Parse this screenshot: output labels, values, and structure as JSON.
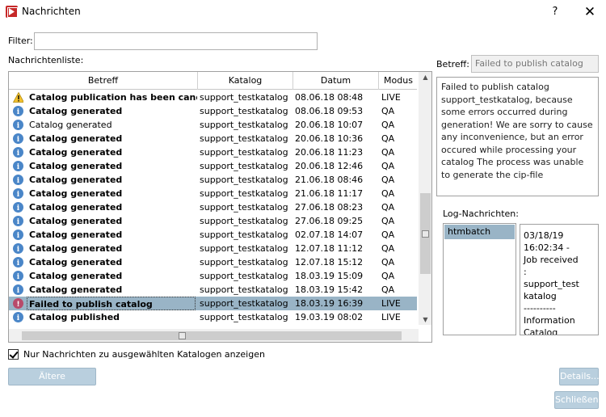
{
  "window": {
    "title": "Nachrichten",
    "help": "?",
    "close": "✕"
  },
  "filter": {
    "label": "Filter:",
    "value": ""
  },
  "list": {
    "label": "Nachrichtenliste:",
    "columns": [
      "Betreff",
      "Katalog",
      "Datum",
      "Modus"
    ],
    "rows": [
      {
        "icon": "warning",
        "betreff": "Catalog publication has been cancelled",
        "katalog": "support_testkatalog",
        "datum": "08.06.18 08:48",
        "modus": "LIVE",
        "bold": true
      },
      {
        "icon": "info",
        "betreff": "Catalog generated",
        "katalog": "support_testkatalog",
        "datum": "08.06.18 09:53",
        "modus": "QA",
        "bold": true
      },
      {
        "icon": "info",
        "betreff": "Catalog generated",
        "katalog": "support_testkatalog",
        "datum": "20.06.18 10:07",
        "modus": "QA",
        "bold": false
      },
      {
        "icon": "info",
        "betreff": "Catalog generated",
        "katalog": "support_testkatalog",
        "datum": "20.06.18 10:36",
        "modus": "QA",
        "bold": true
      },
      {
        "icon": "info",
        "betreff": "Catalog generated",
        "katalog": "support_testkatalog",
        "datum": "20.06.18 11:23",
        "modus": "QA",
        "bold": true
      },
      {
        "icon": "info",
        "betreff": "Catalog generated",
        "katalog": "support_testkatalog",
        "datum": "20.06.18 12:46",
        "modus": "QA",
        "bold": true
      },
      {
        "icon": "info",
        "betreff": "Catalog generated",
        "katalog": "support_testkatalog",
        "datum": "21.06.18 08:46",
        "modus": "QA",
        "bold": true
      },
      {
        "icon": "info",
        "betreff": "Catalog generated",
        "katalog": "support_testkatalog",
        "datum": "21.06.18 11:17",
        "modus": "QA",
        "bold": true
      },
      {
        "icon": "info",
        "betreff": "Catalog generated",
        "katalog": "support_testkatalog",
        "datum": "27.06.18 08:23",
        "modus": "QA",
        "bold": true
      },
      {
        "icon": "info",
        "betreff": "Catalog generated",
        "katalog": "support_testkatalog",
        "datum": "27.06.18 09:25",
        "modus": "QA",
        "bold": true
      },
      {
        "icon": "info",
        "betreff": "Catalog generated",
        "katalog": "support_testkatalog",
        "datum": "02.07.18 14:07",
        "modus": "QA",
        "bold": true
      },
      {
        "icon": "info",
        "betreff": "Catalog generated",
        "katalog": "support_testkatalog",
        "datum": "12.07.18 11:12",
        "modus": "QA",
        "bold": true
      },
      {
        "icon": "info",
        "betreff": "Catalog generated",
        "katalog": "support_testkatalog",
        "datum": "12.07.18 15:12",
        "modus": "QA",
        "bold": true
      },
      {
        "icon": "info",
        "betreff": "Catalog generated",
        "katalog": "support_testkatalog",
        "datum": "18.03.19 15:09",
        "modus": "QA",
        "bold": true
      },
      {
        "icon": "info",
        "betreff": "Catalog generated",
        "katalog": "support_testkatalog",
        "datum": "18.03.19 15:42",
        "modus": "QA",
        "bold": true
      },
      {
        "icon": "error",
        "betreff": "Failed to publish catalog",
        "katalog": "support_testkatalog",
        "datum": "18.03.19 16:39",
        "modus": "LIVE",
        "bold": true,
        "selected": true
      },
      {
        "icon": "info",
        "betreff": "Catalog published",
        "katalog": "support_testkatalog",
        "datum": "19.03.19 08:02",
        "modus": "LIVE",
        "bold": true
      }
    ]
  },
  "detail": {
    "betreff_label": "Betreff:",
    "betreff_value": "Failed to publish catalog",
    "message": "Failed to publish catalog support_testkatalog, because some errors occurred during generation! We are sorry to cause any inconvenience, but an error occured while processing your catalog The process was unable to generate the cip-file"
  },
  "log": {
    "label": "Log-Nachrichten:",
    "items": [
      "htmbatch"
    ],
    "detail": "03/18/19\n16:02:34 -\nJob received\n:\nsupport_test\nkatalog\n----------\nInformation\nCatalog"
  },
  "checkbox": {
    "label": "Nur Nachrichten zu ausgewählten Katalogen anzeigen",
    "checked": true
  },
  "buttons": {
    "older": "Ältere Nachrichten...",
    "details": "Details...",
    "close": "Schließen"
  },
  "colors": {
    "selection": "#99b4c6",
    "button": "#b9cfde",
    "info": "#4a86c8",
    "error": "#b84a6a",
    "warning": "#f2c12e"
  }
}
